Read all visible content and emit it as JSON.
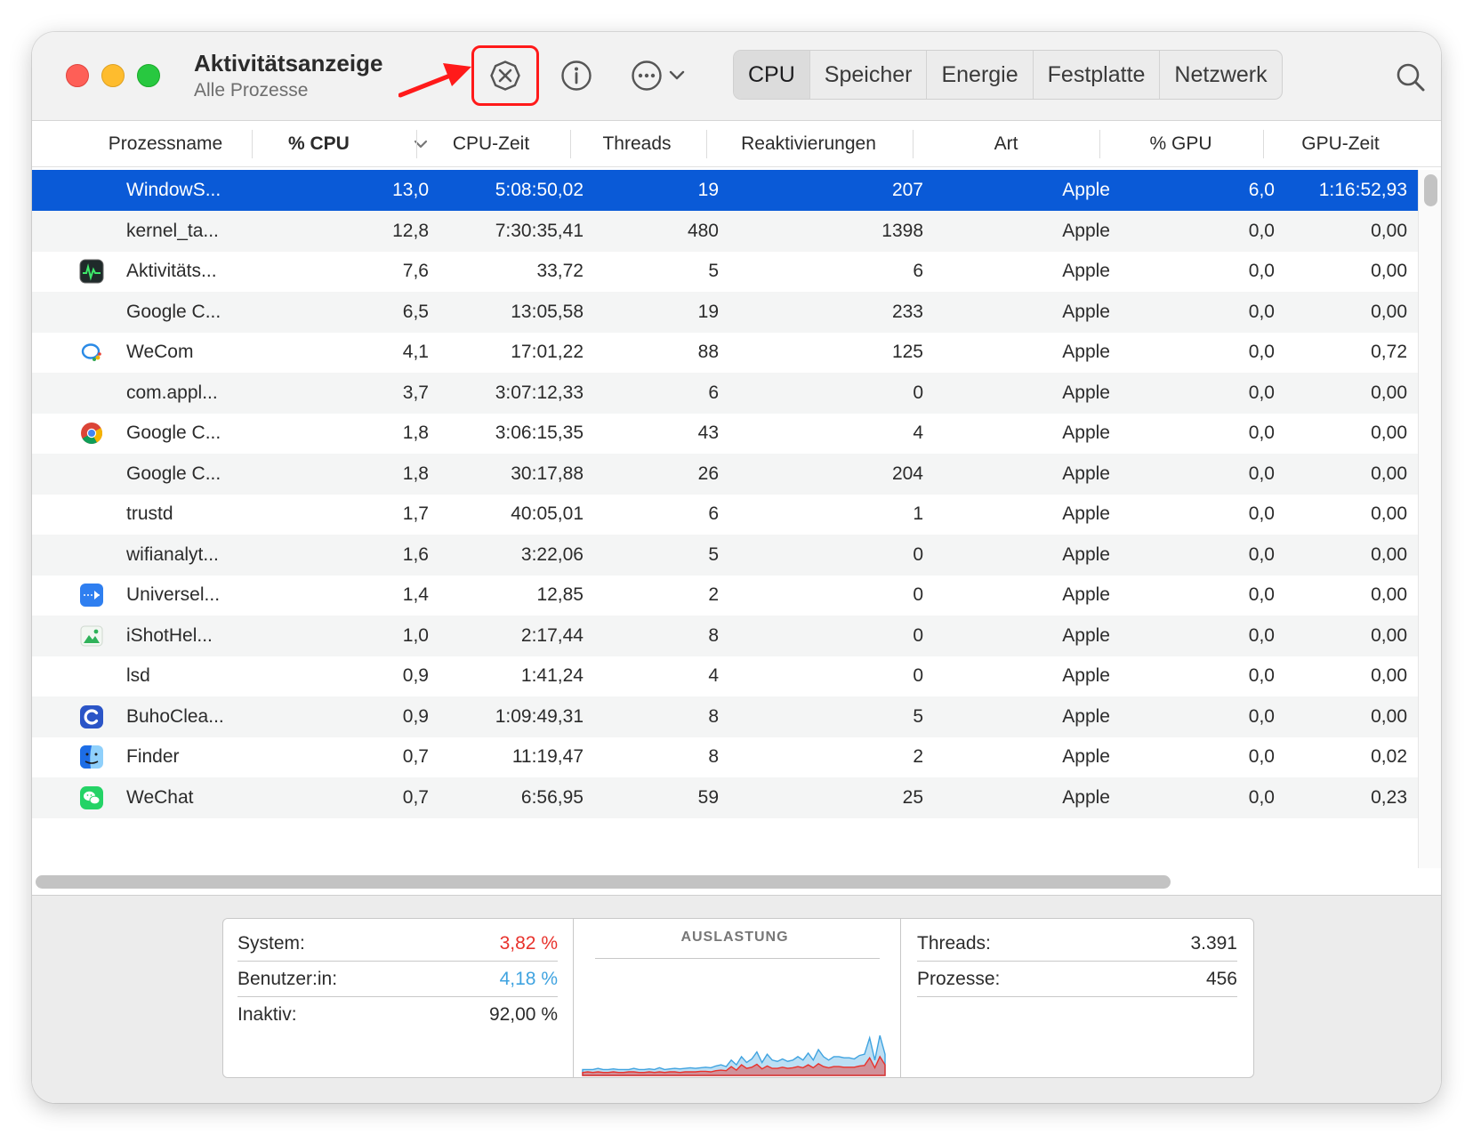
{
  "window": {
    "title": "Aktivitätsanzeige",
    "subtitle": "Alle Prozesse"
  },
  "toolbar": {
    "stop_icon": "xmark-circle-icon",
    "info_icon": "info-circle-icon",
    "more_icon": "ellipsis-circle-icon",
    "search_icon": "magnifying-glass-icon",
    "highlight_color": "#ff1a1a"
  },
  "tabs": [
    {
      "label": "CPU",
      "active": true
    },
    {
      "label": "Speicher",
      "active": false
    },
    {
      "label": "Energie",
      "active": false
    },
    {
      "label": "Festplatte",
      "active": false
    },
    {
      "label": "Netzwerk",
      "active": false
    }
  ],
  "columns": {
    "name": "Prozessname",
    "cpu": "% CPU",
    "cpu_time": "CPU-Zeit",
    "threads": "Threads",
    "wakeups": "Reaktivierungen",
    "kind": "Art",
    "gpu": "% GPU",
    "gpu_time": "GPU-Zeit"
  },
  "rows": [
    {
      "name": "WindowS...",
      "cpu": "13,0",
      "cpu_time": "5:08:50,02",
      "threads": "19",
      "wakeups": "207",
      "kind": "Apple",
      "gpu": "6,0",
      "gpu_time": "1:16:52,93",
      "icon": "none"
    },
    {
      "name": "kernel_ta...",
      "cpu": "12,8",
      "cpu_time": "7:30:35,41",
      "threads": "480",
      "wakeups": "1398",
      "kind": "Apple",
      "gpu": "0,0",
      "gpu_time": "0,00",
      "icon": "none"
    },
    {
      "name": "Aktivitäts...",
      "cpu": "7,6",
      "cpu_time": "33,72",
      "threads": "5",
      "wakeups": "6",
      "kind": "Apple",
      "gpu": "0,0",
      "gpu_time": "0,00",
      "icon": "activity-monitor-icon"
    },
    {
      "name": "Google C...",
      "cpu": "6,5",
      "cpu_time": "13:05,58",
      "threads": "19",
      "wakeups": "233",
      "kind": "Apple",
      "gpu": "0,0",
      "gpu_time": "0,00",
      "icon": "none"
    },
    {
      "name": "WeCom",
      "cpu": "4,1",
      "cpu_time": "17:01,22",
      "threads": "88",
      "wakeups": "125",
      "kind": "Apple",
      "gpu": "0,0",
      "gpu_time": "0,72",
      "icon": "wecom-icon"
    },
    {
      "name": "com.appl...",
      "cpu": "3,7",
      "cpu_time": "3:07:12,33",
      "threads": "6",
      "wakeups": "0",
      "kind": "Apple",
      "gpu": "0,0",
      "gpu_time": "0,00",
      "icon": "none"
    },
    {
      "name": "Google C...",
      "cpu": "1,8",
      "cpu_time": "3:06:15,35",
      "threads": "43",
      "wakeups": "4",
      "kind": "Apple",
      "gpu": "0,0",
      "gpu_time": "0,00",
      "icon": "chrome-icon"
    },
    {
      "name": "Google C...",
      "cpu": "1,8",
      "cpu_time": "30:17,88",
      "threads": "26",
      "wakeups": "204",
      "kind": "Apple",
      "gpu": "0,0",
      "gpu_time": "0,00",
      "icon": "none"
    },
    {
      "name": "trustd",
      "cpu": "1,7",
      "cpu_time": "40:05,01",
      "threads": "6",
      "wakeups": "1",
      "kind": "Apple",
      "gpu": "0,0",
      "gpu_time": "0,00",
      "icon": "none"
    },
    {
      "name": "wifianalyt...",
      "cpu": "1,6",
      "cpu_time": "3:22,06",
      "threads": "5",
      "wakeups": "0",
      "kind": "Apple",
      "gpu": "0,0",
      "gpu_time": "0,00",
      "icon": "none"
    },
    {
      "name": "Universel...",
      "cpu": "1,4",
      "cpu_time": "12,85",
      "threads": "2",
      "wakeups": "0",
      "kind": "Apple",
      "gpu": "0,0",
      "gpu_time": "0,00",
      "icon": "universal-control-icon"
    },
    {
      "name": "iShotHel...",
      "cpu": "1,0",
      "cpu_time": "2:17,44",
      "threads": "8",
      "wakeups": "0",
      "kind": "Apple",
      "gpu": "0,0",
      "gpu_time": "0,00",
      "icon": "ishot-icon"
    },
    {
      "name": "lsd",
      "cpu": "0,9",
      "cpu_time": "1:41,24",
      "threads": "4",
      "wakeups": "0",
      "kind": "Apple",
      "gpu": "0,0",
      "gpu_time": "0,00",
      "icon": "none"
    },
    {
      "name": "BuhoClea...",
      "cpu": "0,9",
      "cpu_time": "1:09:49,31",
      "threads": "8",
      "wakeups": "5",
      "kind": "Apple",
      "gpu": "0,0",
      "gpu_time": "0,00",
      "icon": "buhocleaner-icon"
    },
    {
      "name": "Finder",
      "cpu": "0,7",
      "cpu_time": "11:19,47",
      "threads": "8",
      "wakeups": "2",
      "kind": "Apple",
      "gpu": "0,0",
      "gpu_time": "0,02",
      "icon": "finder-icon"
    },
    {
      "name": "WeChat",
      "cpu": "0,7",
      "cpu_time": "6:56,95",
      "threads": "59",
      "wakeups": "25",
      "kind": "Apple",
      "gpu": "0,0",
      "gpu_time": "0,23",
      "icon": "wechat-icon"
    }
  ],
  "stats": {
    "system_label": "System:",
    "system_value": "3,82 %",
    "user_label": "Benutzer:in:",
    "user_value": "4,18 %",
    "idle_label": "Inaktiv:",
    "idle_value": "92,00 %",
    "chart_title": "AUSLASTUNG",
    "threads_label": "Threads:",
    "threads_value": "3.391",
    "processes_label": "Prozesse:",
    "processes_value": "456",
    "system_color": "#e8322c",
    "user_color": "#3fa3e0"
  },
  "load_history": {
    "user": [
      1,
      1,
      1,
      1.2,
      1,
      1,
      1.1,
      1,
      1,
      1,
      1.2,
      1,
      1,
      1.1,
      1,
      1.3,
      1,
      1.1,
      1.2,
      1.1,
      1.2,
      1.3,
      1.2,
      1.3,
      1.4,
      1.3,
      1.6,
      1.8,
      1.5,
      2.6,
      1.8,
      3.2,
      2.2,
      2.8,
      4.0,
      2.2,
      3.6,
      2.6,
      2.4,
      2.8,
      2.4,
      2.6,
      3.2,
      2.6,
      3.8,
      2.6,
      4.4,
      3.2,
      2.6,
      3.2,
      3.2,
      3.0,
      3.0,
      2.8,
      3.4,
      3.6,
      6.4,
      2.6,
      6.8,
      3.6
    ],
    "system": [
      0.5,
      0.6,
      0.5,
      0.6,
      0.5,
      0.5,
      0.6,
      0.5,
      0.5,
      0.6,
      0.6,
      0.5,
      0.5,
      0.6,
      0.5,
      0.6,
      0.5,
      0.6,
      0.6,
      0.5,
      0.6,
      0.6,
      0.6,
      0.7,
      0.7,
      0.6,
      0.8,
      0.9,
      0.8,
      1.5,
      0.9,
      1.8,
      1.2,
      1.4,
      1.9,
      1.1,
      1.6,
      1.2,
      1.2,
      1.4,
      1.2,
      1.3,
      1.5,
      1.3,
      1.8,
      1.3,
      2.0,
      1.5,
      1.3,
      1.5,
      1.5,
      1.4,
      1.4,
      1.4,
      1.6,
      1.7,
      3.0,
      1.3,
      3.2,
      1.8
    ]
  }
}
